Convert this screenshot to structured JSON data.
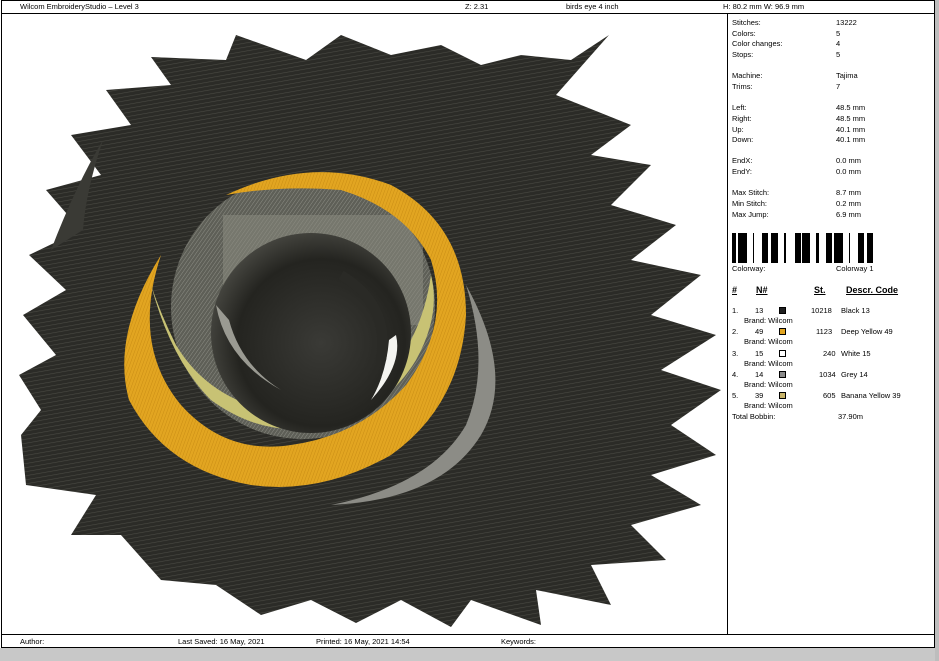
{
  "header": {
    "app_title": "Wilcom EmbroideryStudio – Level 3",
    "zoom": "Z: 2.31",
    "design_name": "birds eye 4 inch",
    "dimensions": "H: 80.2 mm   W: 96.9 mm"
  },
  "stats": [
    {
      "label": "Stitches:",
      "value": "13222"
    },
    {
      "label": "Colors:",
      "value": "5"
    },
    {
      "label": "Color changes:",
      "value": "4"
    },
    {
      "label": "Stops:",
      "value": "5"
    },
    {
      "label": "Machine:",
      "value": "Tajima"
    },
    {
      "label": "Trims:",
      "value": "7"
    },
    {
      "label": "Left:",
      "value": "48.5 mm"
    },
    {
      "label": "Right:",
      "value": "48.5 mm"
    },
    {
      "label": "Up:",
      "value": "40.1 mm"
    },
    {
      "label": "Down:",
      "value": "40.1 mm"
    },
    {
      "label": "EndX:",
      "value": "0.0 mm"
    },
    {
      "label": "EndY:",
      "value": "0.0 mm"
    },
    {
      "label": "Max Stitch:",
      "value": "8.7 mm"
    },
    {
      "label": "Min Stitch:",
      "value": "0.2 mm"
    },
    {
      "label": "Max Jump:",
      "value": "6.9 mm"
    }
  ],
  "colorway": {
    "label": "Colorway:",
    "value": "Colorway 1"
  },
  "color_table": {
    "headers": {
      "num": "#",
      "n": "N#",
      "st": "St.",
      "descr": "Descr. Code"
    },
    "rows": [
      {
        "index": "1.",
        "n": "13",
        "swatch": "#1f1f1f",
        "st": "10218",
        "descr": "Black 13",
        "brand": "Brand: Wilcom"
      },
      {
        "index": "2.",
        "n": "49",
        "swatch": "#e2a521",
        "st": "1123",
        "descr": "Deep Yellow 49",
        "brand": "Brand: Wilcom"
      },
      {
        "index": "3.",
        "n": "15",
        "swatch": "#ffffff",
        "st": "240",
        "descr": "White 15",
        "brand": "Brand: Wilcom"
      },
      {
        "index": "4.",
        "n": "14",
        "swatch": "#8a8a8a",
        "st": "1034",
        "descr": "Grey 14",
        "brand": "Brand: Wilcom"
      },
      {
        "index": "5.",
        "n": "39",
        "swatch": "#c8b46a",
        "st": "605",
        "descr": "Banana Yellow 39",
        "brand": "Brand: Wilcom"
      }
    ],
    "total_bobbin_label": "Total Bobbin:",
    "total_bobbin_value": "37.90m"
  },
  "footer": {
    "author": "Author:",
    "last_saved": "Last Saved: 16 May, 2021",
    "printed": "Printed: 16 May, 2021 14:54",
    "keywords": "Keywords:"
  },
  "colors": {
    "thread_black": "#2b2b27",
    "deep_yellow": "#e2a521",
    "banana_yellow": "#c8c274",
    "grey": "#8c8c86"
  }
}
